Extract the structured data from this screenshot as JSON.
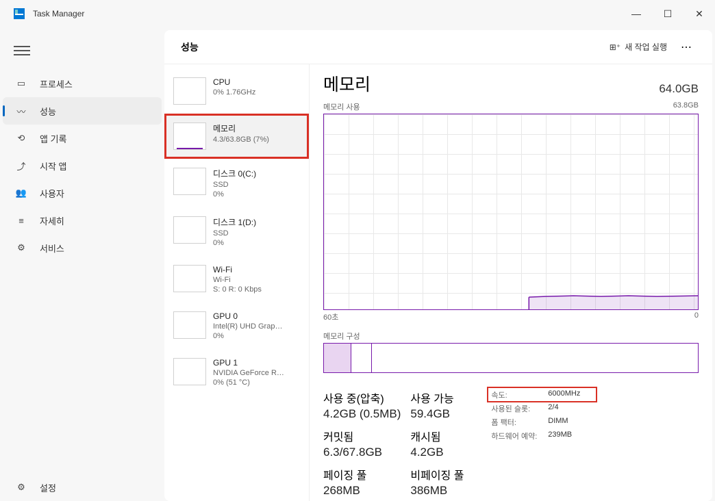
{
  "app_title": "Task Manager",
  "window_buttons": {
    "min": "—",
    "max": "☐",
    "close": "✕"
  },
  "nav": {
    "items": [
      {
        "label": "프로세스",
        "icon": "processes"
      },
      {
        "label": "성능",
        "icon": "performance",
        "active": true
      },
      {
        "label": "앱 기록",
        "icon": "history"
      },
      {
        "label": "시작 앱",
        "icon": "startup"
      },
      {
        "label": "사용자",
        "icon": "users"
      },
      {
        "label": "자세히",
        "icon": "details"
      },
      {
        "label": "서비스",
        "icon": "services"
      }
    ],
    "settings_label": "설정"
  },
  "header": {
    "title": "성능",
    "new_task": "새 작업 실행",
    "more": "⋯"
  },
  "perf_items": [
    {
      "title": "CPU",
      "sub": "0% 1.76GHz"
    },
    {
      "title": "메모리",
      "sub": "4.3/63.8GB (7%)",
      "selected": true
    },
    {
      "title": "디스크 0(C:)",
      "sub": "SSD",
      "sub2": "0%"
    },
    {
      "title": "디스크 1(D:)",
      "sub": "SSD",
      "sub2": "0%"
    },
    {
      "title": "Wi-Fi",
      "sub": "Wi-Fi",
      "sub2": "S: 0 R: 0 Kbps"
    },
    {
      "title": "GPU 0",
      "sub": "Intel(R) UHD Grap…",
      "sub2": "0%"
    },
    {
      "title": "GPU 1",
      "sub": "NVIDIA GeForce R…",
      "sub2": "0% (51 °C)"
    }
  ],
  "detail": {
    "heading": "메모리",
    "total": "64.0GB",
    "usage_label": "메모리 사용",
    "usage_max": "63.8GB",
    "time_left": "60초",
    "time_right": "0",
    "comp_label": "메모리 구성",
    "stats": {
      "in_use_label": "사용 중(압축)",
      "in_use_value": "4.2GB (0.5MB)",
      "avail_label": "사용 가능",
      "avail_value": "59.4GB",
      "committed_label": "커밋됨",
      "committed_value": "6.3/67.8GB",
      "cached_label": "캐시됨",
      "cached_value": "4.2GB",
      "paged_label": "페이징 풀",
      "paged_value": "268MB",
      "nonpaged_label": "비페이징 풀",
      "nonpaged_value": "386MB"
    },
    "right": {
      "speed_label": "속도:",
      "speed_value": "6000MHz",
      "slots_label": "사용된 슬롯:",
      "slots_value": "2/4",
      "form_label": "폼 팩터:",
      "form_value": "DIMM",
      "hw_label": "하드웨어 예약:",
      "hw_value": "239MB"
    }
  },
  "chart_data": {
    "type": "line",
    "title": "메모리 사용",
    "xlabel": "초",
    "ylabel": "GB",
    "ylim": [
      0,
      63.8
    ],
    "x_range_seconds": [
      60,
      0
    ],
    "series": [
      {
        "name": "memory_in_use_gb",
        "values": [
          4.2,
          4.2,
          4.2,
          4.2,
          4.2,
          4.3,
          4.3,
          4.3,
          4.3,
          4.3,
          4.3,
          4.3,
          4.3,
          4.3,
          4.3
        ]
      }
    ],
    "note": "history starts ~55% across time axis; earlier portion empty"
  }
}
